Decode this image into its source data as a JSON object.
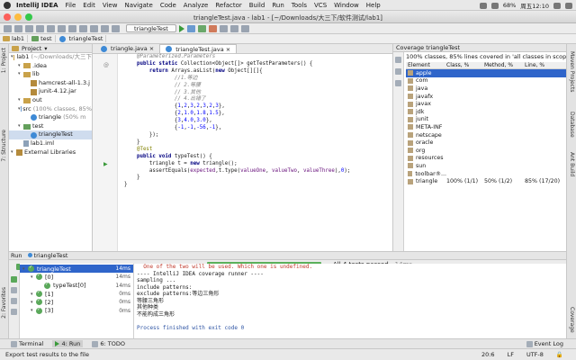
{
  "menubar": {
    "app": "IntelliJ IDEA",
    "items": [
      "File",
      "Edit",
      "View",
      "Navigate",
      "Code",
      "Analyze",
      "Refactor",
      "Build",
      "Run",
      "Tools",
      "VCS",
      "Window",
      "Help"
    ],
    "battery": "68%",
    "clock": "周五12:10"
  },
  "window": {
    "title": "triangleTest.java - lab1 - [~/Downloads/大三下/软件测试/lab1]"
  },
  "toolbar": {
    "run_config": "triangleTest"
  },
  "breadcrumb": [
    "lab1",
    "test",
    "triangleTest"
  ],
  "left_stripe": {
    "project_tab": "1: Project",
    "structure_tab": "7: Structure",
    "favorites_tab": "2: Favorites"
  },
  "project": {
    "header": "Project",
    "tree": [
      {
        "label": "lab1",
        "suffix": "(~/Downloads/大三下",
        "indent": 0,
        "icon": "folder"
      },
      {
        "label": ".idea",
        "suffix": "",
        "indent": 1,
        "icon": "folder"
      },
      {
        "label": "lib",
        "suffix": "",
        "indent": 1,
        "icon": "folder"
      },
      {
        "label": "hamcrest-all-1.3.j",
        "suffix": "",
        "indent": 2,
        "icon": "jar"
      },
      {
        "label": "junit-4.12.jar",
        "suffix": "",
        "indent": 2,
        "icon": "jar"
      },
      {
        "label": "out",
        "suffix": "",
        "indent": 1,
        "icon": "folder"
      },
      {
        "label": "src",
        "suffix": "(100% classes, 85%",
        "indent": 1,
        "icon": "folder-blue"
      },
      {
        "label": "triangle",
        "suffix": "(50% m",
        "indent": 2,
        "icon": "class"
      },
      {
        "label": "test",
        "suffix": "",
        "indent": 1,
        "icon": "folder-green"
      },
      {
        "label": "triangleTest",
        "suffix": "",
        "indent": 2,
        "icon": "class"
      },
      {
        "label": "lab1.iml",
        "suffix": "",
        "indent": 1,
        "icon": "file"
      },
      {
        "label": "External Libraries",
        "suffix": "",
        "indent": 0,
        "icon": "lib"
      }
    ]
  },
  "editor": {
    "tabs": [
      {
        "label": "triangle.java",
        "active": false
      },
      {
        "label": "triangleTest.java",
        "active": true
      }
    ],
    "lines": [
      [
        [
          "cm",
          "    @Parameterized.Parameters"
        ]
      ],
      [
        [
          "kw",
          "    public static "
        ],
        [
          "",
          "Collection<Object[]> getTestParameters() {"
        ]
      ],
      [
        [
          "kw",
          "        return "
        ],
        [
          "",
          "Arrays.asList("
        ],
        [
          "kw",
          "new "
        ],
        [
          "",
          "Object[][]{"
        ]
      ],
      [
        [
          "cm",
          "                //1.等边"
        ]
      ],
      [
        [
          "cm",
          "                // 2.等腰"
        ]
      ],
      [
        [
          "cm",
          "                // 3.其他"
        ]
      ],
      [
        [
          "cm",
          "                // 4.出错了"
        ]
      ],
      [
        [
          "",
          "                {"
        ],
        [
          "num",
          "1"
        ],
        [
          "",
          ","
        ],
        [
          "num",
          "2"
        ],
        [
          "",
          ","
        ],
        [
          "num",
          "3"
        ],
        [
          "",
          ","
        ],
        [
          "num",
          "2"
        ],
        [
          "",
          ","
        ],
        [
          "num",
          "3"
        ],
        [
          "",
          ","
        ],
        [
          "num",
          "2"
        ],
        [
          "",
          ","
        ],
        [
          "num",
          "3"
        ],
        [
          "",
          "},"
        ]
      ],
      [
        [
          "",
          "                {"
        ],
        [
          "num",
          "2"
        ],
        [
          "",
          ","
        ],
        [
          "num",
          "1.0"
        ],
        [
          "",
          ","
        ],
        [
          "num",
          "1.8"
        ],
        [
          "",
          ","
        ],
        [
          "num",
          "1.5"
        ],
        [
          "",
          "},"
        ]
      ],
      [
        [
          "",
          "                {"
        ],
        [
          "num",
          "3"
        ],
        [
          "",
          ","
        ],
        [
          "num",
          "4.0"
        ],
        [
          "",
          ","
        ],
        [
          "num",
          "3.0"
        ],
        [
          "",
          "},"
        ]
      ],
      [
        [
          "",
          "                {"
        ],
        [
          "num",
          "-1"
        ],
        [
          "",
          ","
        ],
        [
          "num",
          "-1"
        ],
        [
          "",
          ","
        ],
        [
          "num",
          "-56"
        ],
        [
          "",
          ","
        ],
        [
          "num",
          "-1"
        ],
        [
          "",
          "},"
        ]
      ],
      [
        [
          "",
          "        });"
        ]
      ],
      [
        [
          "",
          "    }"
        ]
      ],
      [
        [
          "",
          ""
        ]
      ],
      [
        [
          "ann",
          "    @Test"
        ]
      ],
      [
        [
          "kw",
          "    public void "
        ],
        [
          "",
          "typeTest() {"
        ]
      ],
      [
        [
          "",
          "        triangle t = "
        ],
        [
          "kw",
          "new "
        ],
        [
          "",
          "triangle();"
        ]
      ],
      [
        [
          "",
          "        assertEquals("
        ],
        [
          "fld",
          "expected"
        ],
        [
          "",
          ",t.type("
        ],
        [
          "fld",
          "valueOne"
        ],
        [
          "",
          ", "
        ],
        [
          "fld",
          "valueTwo"
        ],
        [
          "",
          ", "
        ],
        [
          "fld",
          "valueThree"
        ],
        [
          "",
          "),"
        ],
        [
          "num",
          "0"
        ],
        [
          "",
          ");"
        ]
      ],
      [
        [
          "",
          "    }"
        ]
      ],
      [
        [
          "",
          ""
        ]
      ],
      [
        [
          "",
          "}"
        ]
      ]
    ]
  },
  "coverage": {
    "header": "Coverage triangleTest",
    "summary": "100% classes, 85% lines covered in 'all classes in scope'",
    "columns": [
      "Element",
      "Class, %",
      "Method, %",
      "Line, %"
    ],
    "rows": [
      [
        "apple",
        "",
        "",
        ""
      ],
      [
        "com",
        "",
        "",
        ""
      ],
      [
        "java",
        "",
        "",
        ""
      ],
      [
        "javafx",
        "",
        "",
        ""
      ],
      [
        "javax",
        "",
        "",
        ""
      ],
      [
        "jdk",
        "",
        "",
        ""
      ],
      [
        "junit",
        "",
        "",
        ""
      ],
      [
        "META-INF",
        "",
        "",
        ""
      ],
      [
        "netscape",
        "",
        "",
        ""
      ],
      [
        "oracle",
        "",
        "",
        ""
      ],
      [
        "org",
        "",
        "",
        ""
      ],
      [
        "resources",
        "",
        "",
        ""
      ],
      [
        "sun",
        "",
        "",
        ""
      ],
      [
        "toolbar®...",
        "",
        "",
        ""
      ],
      [
        "triangle",
        "100% (1/1)",
        "50% (1/2)",
        "85% (17/20)"
      ]
    ]
  },
  "right_stripe": {
    "maven": "Maven Projects",
    "database": "Database",
    "ant": "Ant Build",
    "coverage": "Coverage"
  },
  "run": {
    "header": "Run",
    "config": "triangleTest",
    "tests_passed": "All 4 tests passed",
    "duration": "- 14ms",
    "progress": 1.0,
    "tree": [
      {
        "label": "triangleTest",
        "time": "14ms",
        "indent": 0,
        "selected": true
      },
      {
        "label": "[0]",
        "time": "14ms",
        "indent": 1,
        "selected": false
      },
      {
        "label": "typeTest[0]",
        "time": "14ms",
        "indent": 2,
        "selected": false
      },
      {
        "label": "[1]",
        "time": "0ms",
        "indent": 1,
        "selected": false
      },
      {
        "label": "[2]",
        "time": "0ms",
        "indent": 1,
        "selected": false
      },
      {
        "label": "[3]",
        "time": "0ms",
        "indent": 1,
        "selected": false
      }
    ],
    "console": [
      {
        "text": "  One of the two will be used. Which one is undefined.",
        "kind": "err"
      },
      {
        "text": "---- IntelliJ IDEA coverage runner ----",
        "kind": ""
      },
      {
        "text": "sampling ...",
        "kind": ""
      },
      {
        "text": "include patterns:",
        "kind": ""
      },
      {
        "text": "exclude patterns:等边三角形",
        "kind": ""
      },
      {
        "text": "等腰三角形",
        "kind": ""
      },
      {
        "text": "其他种类",
        "kind": ""
      },
      {
        "text": "不能构成三角形",
        "kind": ""
      },
      {
        "text": "",
        "kind": ""
      },
      {
        "text": "Process finished with exit code 0",
        "kind": "fin"
      }
    ]
  },
  "bottom_tabs": [
    {
      "label": "Terminal",
      "active": false
    },
    {
      "label": "4: Run",
      "active": true
    },
    {
      "label": "6: TODO",
      "active": false
    }
  ],
  "event_log": "Event Log",
  "status": {
    "message": "Export test results to the file",
    "position": "20:6",
    "line_sep": "LF",
    "encoding": "UTF-8"
  }
}
